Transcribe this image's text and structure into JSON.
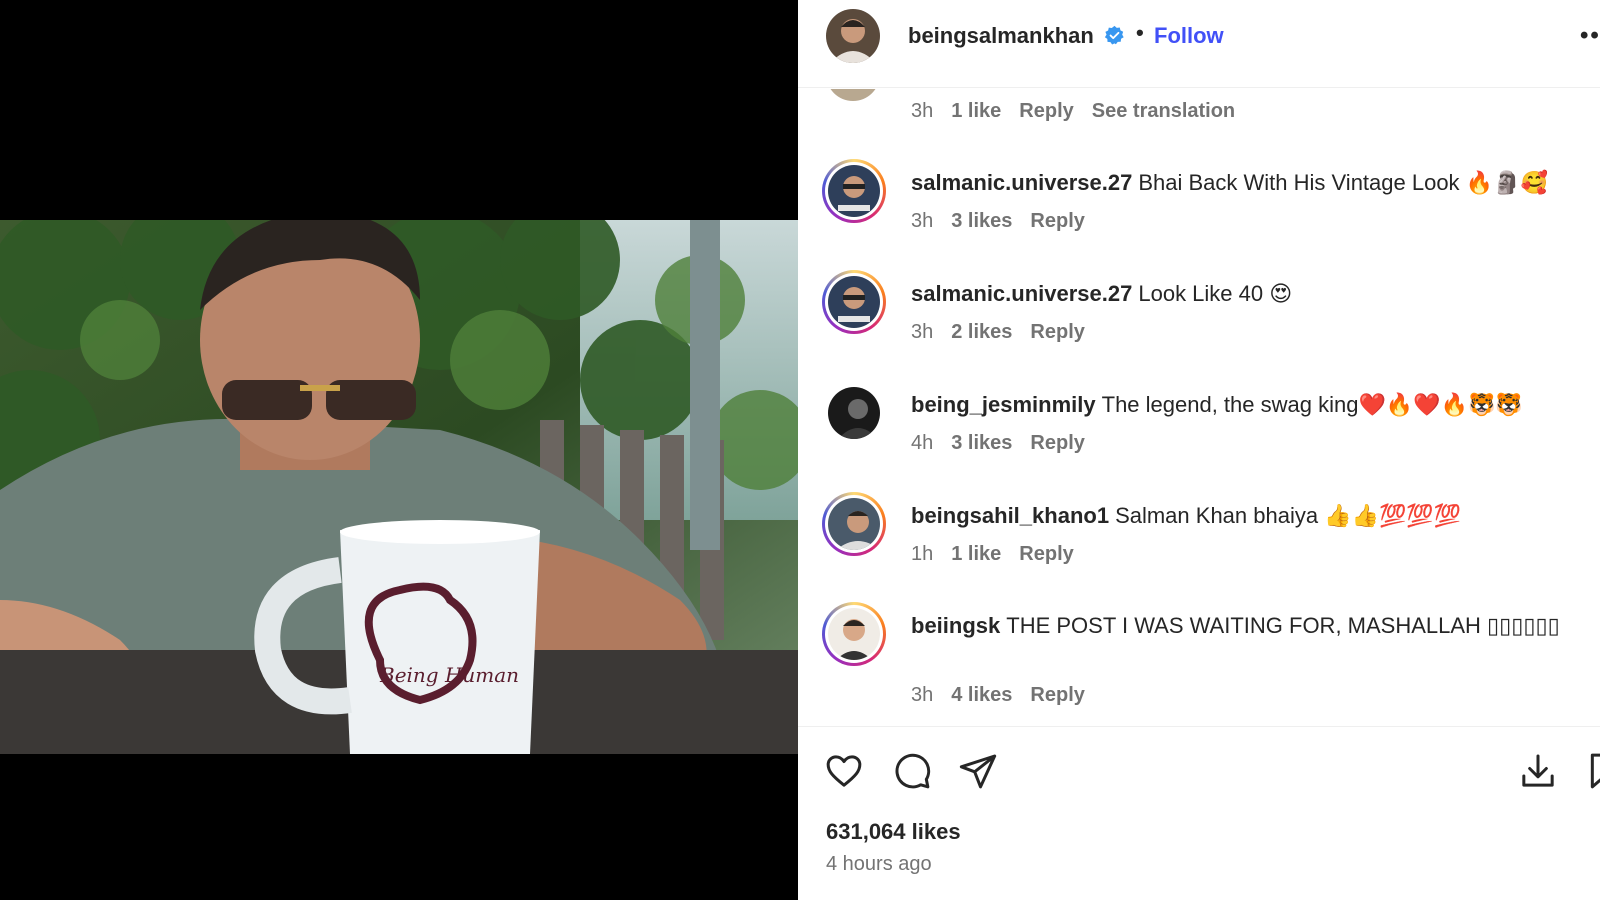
{
  "post": {
    "username": "beingsalmankhan",
    "follow_label": "Follow",
    "separator": "•",
    "more_label": "••",
    "mug_text": "Being Human"
  },
  "comments": [
    {
      "time": "3h",
      "likes": "1 like",
      "reply": "Reply",
      "translate": "See translation"
    },
    {
      "user": "salmanic.universe.27",
      "text": "Bhai Back With His Vintage Look 🔥🗿🥰",
      "time": "3h",
      "likes": "3 likes",
      "reply": "Reply"
    },
    {
      "user": "salmanic.universe.27",
      "text": "Look Like 40 😍",
      "time": "3h",
      "likes": "2 likes",
      "reply": "Reply"
    },
    {
      "user": "being_jesminmily",
      "text": "The legend, the swag king❤️🔥❤️🔥🐯🐯",
      "time": "4h",
      "likes": "3 likes",
      "reply": "Reply"
    },
    {
      "user": "beingsahil_khano1",
      "text": "Salman Khan bhaiya 👍👍💯💯💯",
      "time": "1h",
      "likes": "1 like",
      "reply": "Reply"
    },
    {
      "user": "beiingsk",
      "text": "THE POST I WAS WAITING FOR, MASHALLAH ▯▯▯▯▯▯",
      "time": "3h",
      "likes": "4 likes",
      "reply": "Reply"
    }
  ],
  "footer": {
    "likes": "631,064 likes",
    "posted": "4 hours ago"
  },
  "icons": {
    "like": "heart-icon",
    "comment": "comment-bubble-icon",
    "share": "paper-plane-icon",
    "download": "download-icon",
    "save": "bookmark-icon",
    "verified": "verified-badge-icon"
  },
  "colors": {
    "follow": "#4150f7",
    "verified": "#3897f0",
    "muted": "#737373",
    "text": "#262626"
  }
}
